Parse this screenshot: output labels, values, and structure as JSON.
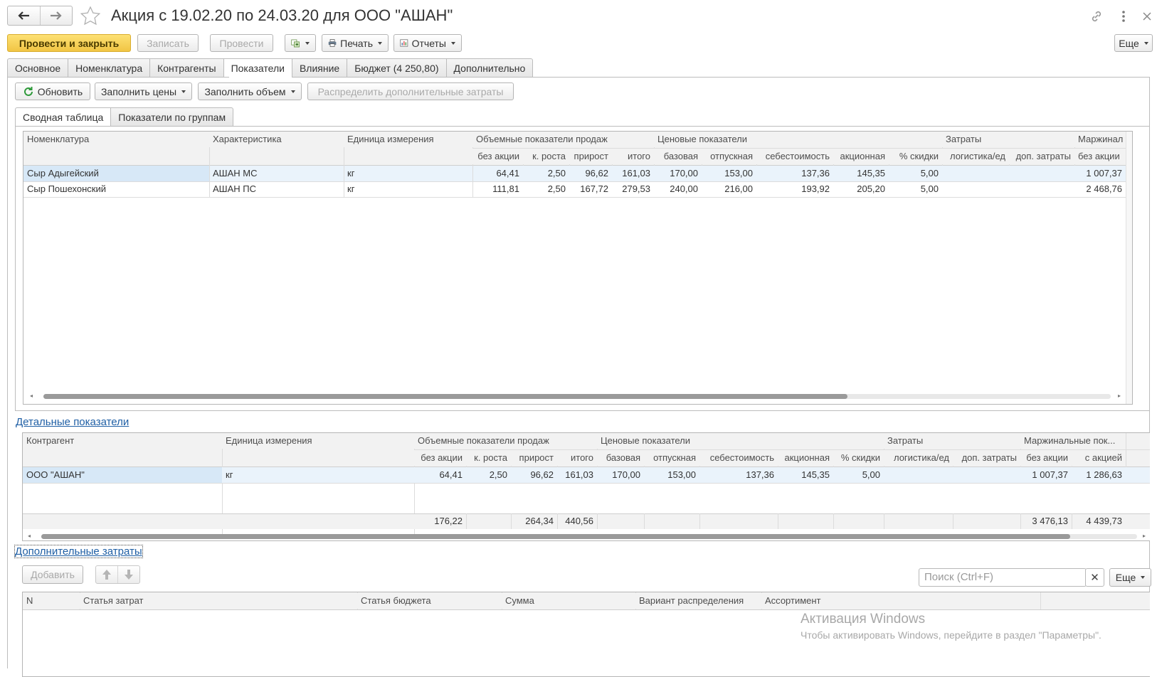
{
  "window": {
    "title": "Акция с 19.02.20 по 24.03.20 для ООО \"АШАН\""
  },
  "toolbar": {
    "post_close": "Провести и закрыть",
    "save": "Записать",
    "post": "Провести",
    "print": "Печать",
    "reports": "Отчеты",
    "more": "Еще"
  },
  "tabs": [
    {
      "label": "Основное"
    },
    {
      "label": "Номенклатура"
    },
    {
      "label": "Контрагенты"
    },
    {
      "label": "Показатели"
    },
    {
      "label": "Влияние"
    },
    {
      "label": "Бюджет (4 250,80)"
    },
    {
      "label": "Дополнительно"
    }
  ],
  "actions": {
    "refresh": "Обновить",
    "fill_prices": "Заполнить цены",
    "fill_volume": "Заполнить объем",
    "distribute": "Распределить дополнительные затраты"
  },
  "subtabs": [
    {
      "label": "Сводная таблица"
    },
    {
      "label": "Показатели по группам"
    }
  ],
  "summary_table": {
    "group_headers": {
      "nomenclature": "Номенклатура",
      "characteristic": "Характеристика",
      "unit": "Единица измерения",
      "volume": "Объемные показатели продаж",
      "price": "Ценовые показатели",
      "costs": "Затраты",
      "margin": "Маржинал"
    },
    "sub_headers": {
      "no_promo": "без акции",
      "growth": "к. роста",
      "increase": "прирост",
      "total": "итого",
      "base": "базовая",
      "release": "отпускная",
      "cost": "себестоимость",
      "promo": "акционная",
      "discount": "% скидки",
      "logistics": "логистика/ед",
      "extra": "доп. затраты",
      "margin_no_promo": "без акции"
    },
    "rows": [
      {
        "name": "Сыр Адыгейский",
        "char": "АШАН МС",
        "unit": "кг",
        "no_promo": "64,41",
        "growth": "2,50",
        "increase": "96,62",
        "total": "161,03",
        "base": "170,00",
        "release": "153,00",
        "cost": "137,36",
        "promo": "145,35",
        "discount": "5,00",
        "logistics": "",
        "extra": "",
        "margin": "1 007,37"
      },
      {
        "name": "Сыр Пошехонский",
        "char": "АШАН ПС",
        "unit": "кг",
        "no_promo": "111,81",
        "growth": "2,50",
        "increase": "167,72",
        "total": "279,53",
        "base": "240,00",
        "release": "216,00",
        "cost": "193,92",
        "promo": "205,20",
        "discount": "5,00",
        "logistics": "",
        "extra": "",
        "margin": "2 468,76"
      }
    ]
  },
  "detail": {
    "link": "Детальные показатели",
    "group_headers": {
      "counterparty": "Контрагент",
      "unit": "Единица измерения",
      "volume": "Объемные показатели продаж",
      "price": "Ценовые показатели",
      "costs": "Затраты",
      "margin": "Маржинальные пок..."
    },
    "sub_headers": {
      "no_promo": "без акции",
      "growth": "к. роста",
      "increase": "прирост",
      "total": "итого",
      "base": "базовая",
      "release": "отпускная",
      "cost": "себестоимость",
      "promo": "акционная",
      "discount": "% скидки",
      "logistics": "логистика/ед",
      "extra": "доп. затраты",
      "margin_no_promo": "без акции",
      "margin_promo": "с акцией"
    },
    "rows": [
      {
        "name": "ООО \"АШАН\"",
        "unit": "кг",
        "no_promo": "64,41",
        "growth": "2,50",
        "increase": "96,62",
        "total": "161,03",
        "base": "170,00",
        "release": "153,00",
        "cost": "137,36",
        "promo": "145,35",
        "discount": "5,00",
        "logistics": "",
        "extra": "",
        "margin_no_promo": "1 007,37",
        "margin_promo": "1 286,63"
      }
    ],
    "totals": {
      "no_promo": "176,22",
      "increase": "264,34",
      "total": "440,56",
      "margin_no_promo": "3 476,13",
      "margin_promo": "4 439,73"
    }
  },
  "extra_costs": {
    "link": "Дополнительные затраты",
    "add": "Добавить",
    "search_placeholder": "Поиск (Ctrl+F)",
    "more": "Еще",
    "columns": [
      "N",
      "Статья затрат",
      "Статья бюджета",
      "Сумма",
      "Вариант распределения",
      "Ассортимент"
    ]
  },
  "watermark": {
    "title": "Активация Windows",
    "text": "Чтобы активировать Windows, перейдите в раздел \"Параметры\"."
  },
  "colors": {
    "primary_button": "#f1c544",
    "link": "#1f5fa5",
    "selected_row": "#eaf3fb"
  }
}
